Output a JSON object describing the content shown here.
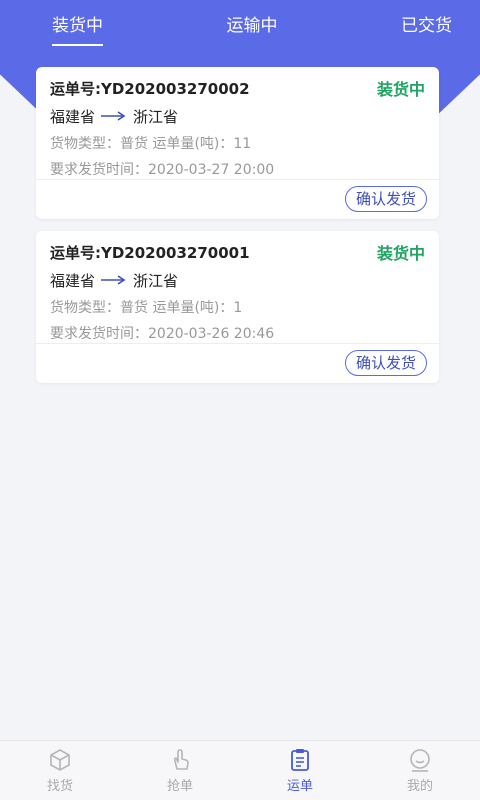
{
  "tabs": [
    {
      "label": "装货中",
      "active": true
    },
    {
      "label": "运输中",
      "active": false
    },
    {
      "label": "已交货",
      "active": false
    }
  ],
  "orders": [
    {
      "order_no": "运单号:YD202003270002",
      "status": "装货中",
      "from": "福建省",
      "to": "浙江省",
      "cargo": "货物类型：普货 运单量(吨)：11",
      "time": "要求发货时间：2020-03-27 20:00",
      "button": "确认发货"
    },
    {
      "order_no": "运单号:YD202003270001",
      "status": "装货中",
      "from": "福建省",
      "to": "浙江省",
      "cargo": "货物类型：普货 运单量(吨)：1",
      "time": "要求发货时间：2020-03-26 20:46",
      "button": "确认发货"
    }
  ],
  "bottom_nav": [
    {
      "label": "找货",
      "icon": "box-icon",
      "active": false
    },
    {
      "label": "抢单",
      "icon": "hand-tap-icon",
      "active": false
    },
    {
      "label": "运单",
      "icon": "clipboard-icon",
      "active": true
    },
    {
      "label": "我的",
      "icon": "smile-icon",
      "active": false
    }
  ],
  "colors": {
    "header": "#5b6ae6",
    "status_green": "#1fa463",
    "button_border": "#5b6ae6",
    "nav_active": "#4b5bd4"
  }
}
